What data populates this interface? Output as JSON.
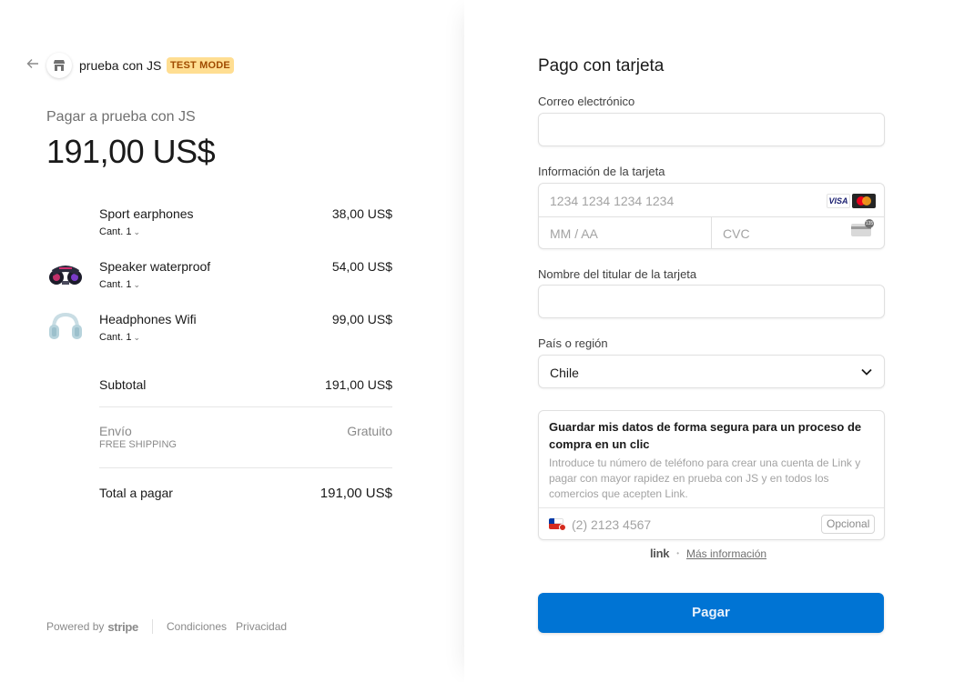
{
  "header": {
    "merchant_name": "prueba con JS",
    "test_mode_badge": "TEST MODE"
  },
  "summary": {
    "pay_to": "Pagar a prueba con JS",
    "total": "191,00 US$"
  },
  "line_items": [
    {
      "name": "Sport earphones",
      "qty": "Cant. 1",
      "price": "38,00 US$",
      "thumb": "none"
    },
    {
      "name": "Speaker waterproof",
      "qty": "Cant. 1",
      "price": "54,00 US$",
      "thumb": "speaker-image"
    },
    {
      "name": "Headphones Wifi",
      "qty": "Cant. 1",
      "price": "99,00 US$",
      "thumb": "headphones-image"
    }
  ],
  "totals": {
    "subtotal_label": "Subtotal",
    "subtotal_value": "191,00 US$",
    "shipping_label": "Envío",
    "shipping_sub": "FREE SHIPPING",
    "shipping_value": "Gratuito",
    "total_label": "Total a pagar",
    "total_value": "191,00 US$"
  },
  "footer": {
    "powered_by": "Powered by",
    "stripe": "stripe",
    "terms": "Condiciones",
    "privacy": "Privacidad"
  },
  "form": {
    "title": "Pago con tarjeta",
    "email_label": "Correo electrónico",
    "email_value": "",
    "card_label": "Información de la tarjeta",
    "card_number_placeholder": "1234 1234 1234 1234",
    "expiry_placeholder": "MM / AA",
    "cvc_placeholder": "CVC",
    "visa_text": "VISA",
    "cardholder_label": "Nombre del titular de la tarjeta",
    "cardholder_value": "",
    "country_label": "País o región",
    "country_value": "Chile"
  },
  "link": {
    "title": "Guardar mis datos de forma segura para un proceso de compra en un clic",
    "description": "Introduce tu número de teléfono para crear una cuenta de Link y pagar con mayor rapidez en prueba con JS y en todos los comercios que acepten Link.",
    "phone_placeholder": "(2) 2123 4567",
    "optional_badge": "Opcional",
    "logo_text": "link",
    "more_info": "Más información"
  },
  "pay_button": "Pagar",
  "colors": {
    "accent": "#0074d4",
    "test_badge_bg": "#ffde92",
    "test_badge_text": "#a04b00"
  }
}
